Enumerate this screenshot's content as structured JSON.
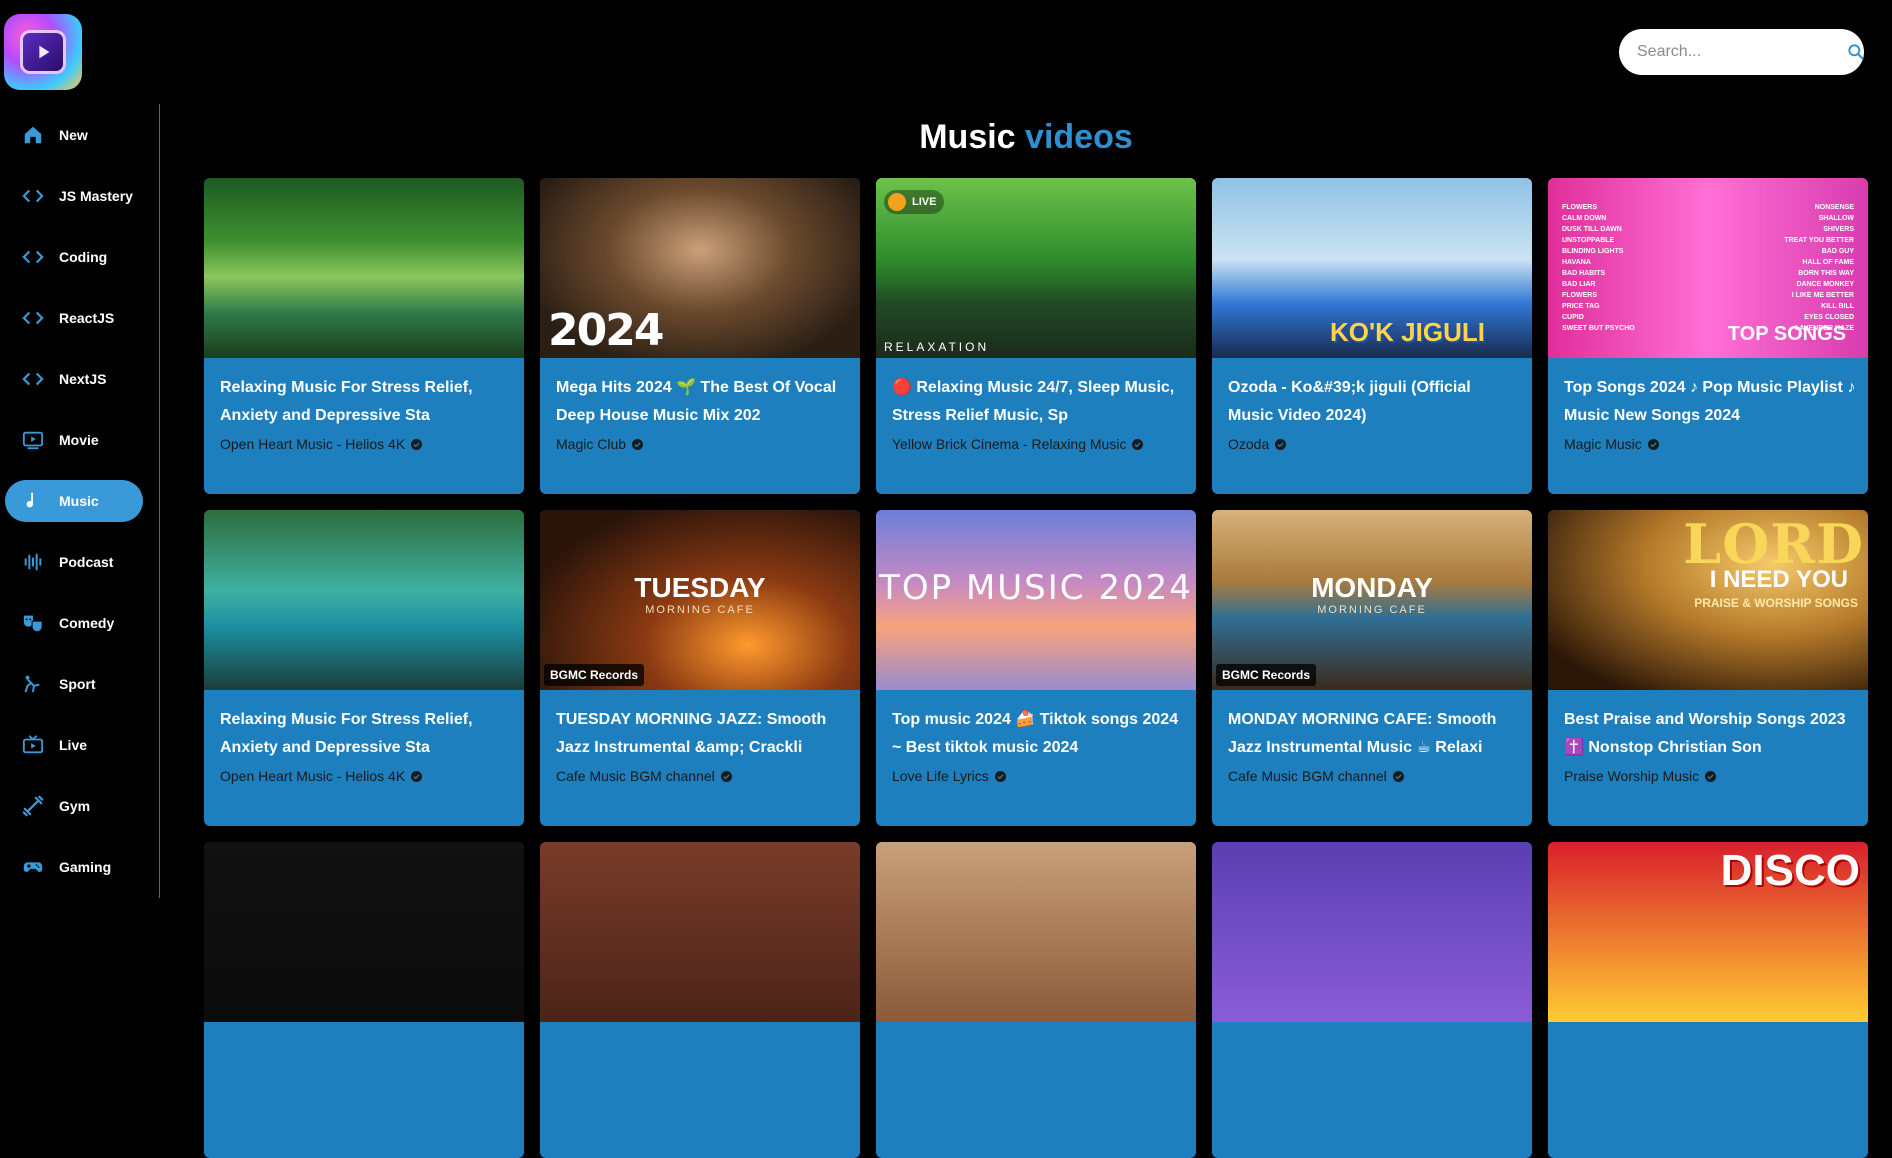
{
  "app": {
    "logo_icon": "play-logo-icon"
  },
  "search": {
    "placeholder": "Search..."
  },
  "sidebar": {
    "items": [
      {
        "label": "New",
        "icon": "home-icon",
        "active": false
      },
      {
        "label": "JS Mastery",
        "icon": "code-icon",
        "active": false
      },
      {
        "label": "Coding",
        "icon": "code-icon",
        "active": false
      },
      {
        "label": "ReactJS",
        "icon": "code-icon",
        "active": false
      },
      {
        "label": "NextJS",
        "icon": "code-icon",
        "active": false
      },
      {
        "label": "Movie",
        "icon": "movie-icon",
        "active": false
      },
      {
        "label": "Music",
        "icon": "music-note-icon",
        "active": true
      },
      {
        "label": "Podcast",
        "icon": "podcast-icon",
        "active": false
      },
      {
        "label": "Comedy",
        "icon": "comedy-mask-icon",
        "active": false
      },
      {
        "label": "Sport",
        "icon": "sport-icon",
        "active": false
      },
      {
        "label": "Live",
        "icon": "live-tv-icon",
        "active": false
      },
      {
        "label": "Gym",
        "icon": "gym-icon",
        "active": false
      },
      {
        "label": "Gaming",
        "icon": "gamepad-icon",
        "active": false
      }
    ]
  },
  "main": {
    "title_prefix": "Music",
    "title_accent": "videos"
  },
  "colors": {
    "accent": "#2e8fd1",
    "card_bg": "#1d7fbd",
    "active_nav": "#3a9ad9",
    "background": "#000000"
  },
  "videos": [
    {
      "title": "Relaxing Music For Stress Relief, Anxiety and Depressive Sta",
      "channel": "Open Heart Music - Helios 4K",
      "verified": true
    },
    {
      "title": "Mega Hits 2024 🌱 The Best Of Vocal Deep House Music Mix 202",
      "channel": "Magic Club",
      "verified": true,
      "thumb_text": "2024"
    },
    {
      "title": "🔴 Relaxing Music 24/7, Sleep Music, Stress Relief Music, Sp",
      "channel": "Yellow Brick Cinema - Relaxing Music",
      "verified": true,
      "thumb_badge": "LIVE",
      "thumb_text": "RELAXATION"
    },
    {
      "title": "Ozoda - Ko&#39;k jiguli (Official Music Video 2024)",
      "channel": "Ozoda",
      "verified": true,
      "thumb_text": "KO'K JIGULI"
    },
    {
      "title": "Top Songs 2024 ♪ Pop Music Playlist ♪ Music New Songs 2024",
      "channel": "Magic Music",
      "verified": true,
      "thumb_text": "TOP SONGS"
    },
    {
      "title": "Relaxing Music For Stress Relief, Anxiety and Depressive Sta",
      "channel": "Open Heart Music - Helios 4K",
      "verified": true
    },
    {
      "title": "TUESDAY MORNING JAZZ: Smooth Jazz Instrumental &amp; Crackli",
      "channel": "Cafe Music BGM channel",
      "verified": true,
      "thumb_text": "TUESDAY",
      "thumb_sub": "MORNING CAFE",
      "thumb_records": "BGMC Records"
    },
    {
      "title": "Top music 2024 🍰 Tiktok songs 2024 ~ Best tiktok music 2024",
      "channel": "Love Life Lyrics",
      "verified": true,
      "thumb_text": "TOP MUSIC 2024"
    },
    {
      "title": "MONDAY MORNING CAFE: Smooth Jazz Instrumental Music ☕ Relaxi",
      "channel": "Cafe Music BGM channel",
      "verified": true,
      "thumb_text": "MONDAY",
      "thumb_sub": "MORNING CAFE",
      "thumb_records": "BGMC Records"
    },
    {
      "title": "Best Praise and Worship Songs 2023 ✝️ Nonstop Christian Son",
      "channel": "Praise Worship Music",
      "verified": true,
      "thumb_text": "LORD",
      "thumb_sub": "I NEED YOU",
      "thumb_sub2": "PRAISE & WORSHIP SONGS"
    }
  ],
  "partial_row": {
    "disco_text": "DISCO"
  },
  "top_songs_left": [
    "FLOWERS",
    "CALM DOWN",
    "DUSK TILL DAWN",
    "UNSTOPPABLE",
    "BLINDING LIGHTS",
    "HAVANA",
    "BAD HABITS",
    "BAD LIAR",
    "FLOWERS",
    "PRICE TAG",
    "CUPID",
    "SWEET BUT PSYCHO"
  ],
  "top_songs_right": [
    "NONSENSE",
    "SHALLOW",
    "SHIVERS",
    "TREAT YOU BETTER",
    "BAD GUY",
    "HALL OF FAME",
    "BORN THIS WAY",
    "DANCE MONKEY",
    "I LIKE ME BETTER",
    "KILL BILL",
    "EYES CLOSED",
    "LAVENDER HAZE"
  ]
}
